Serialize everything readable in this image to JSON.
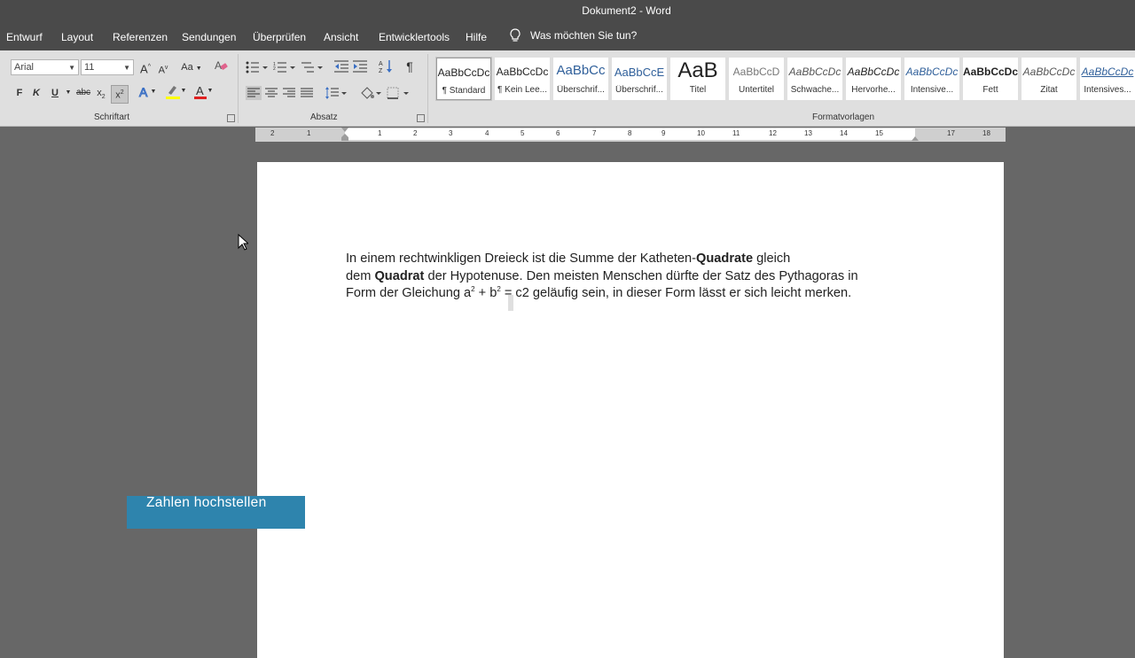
{
  "window": {
    "title_doc": "Dokument2",
    "title_sep": " - ",
    "title_app": "Word"
  },
  "menu": {
    "items": [
      "Entwurf",
      "Layout",
      "Referenzen",
      "Sendungen",
      "Überprüfen",
      "Ansicht",
      "Entwicklertools",
      "Hilfe"
    ],
    "tell_me": "Was möchten Sie tun?"
  },
  "ribbon": {
    "font": {
      "name": "Arial",
      "size": "11",
      "grow_label": "A",
      "shrink_label": "A",
      "case_label": "Aa",
      "bold_label": "F",
      "italic_label": "K",
      "underline_label": "U",
      "strike_label": "abc",
      "sub_label": "x",
      "sup_label": "x",
      "group_label": "Schriftart"
    },
    "paragraph": {
      "group_label": "Absatz"
    },
    "styles": {
      "group_label": "Formatvorlagen",
      "items": [
        {
          "preview": "AaBbCcDc",
          "name": "¶ Standard"
        },
        {
          "preview": "AaBbCcDc",
          "name": "¶ Kein Lee..."
        },
        {
          "preview": "AaBbCc",
          "name": "Überschrif..."
        },
        {
          "preview": "AaBbCcE",
          "name": "Überschrif..."
        },
        {
          "preview": "AaB",
          "name": "Titel"
        },
        {
          "preview": "AaBbCcD",
          "name": "Untertitel"
        },
        {
          "preview": "AaBbCcDc",
          "name": "Schwache..."
        },
        {
          "preview": "AaBbCcDc",
          "name": "Hervorhe..."
        },
        {
          "preview": "AaBbCcDc",
          "name": "Intensive..."
        },
        {
          "preview": "AaBbCcDc",
          "name": "Fett"
        },
        {
          "preview": "AaBbCcDc",
          "name": "Zitat"
        },
        {
          "preview": "AaBbCcDc",
          "name": "Intensives..."
        }
      ]
    },
    "colors": {
      "highlight": "#ffff00",
      "font_color": "#e02020",
      "accent_selected": "#c7c7c7"
    }
  },
  "ruler": {
    "labels": [
      "2",
      "1",
      "1",
      "2",
      "3",
      "4",
      "5",
      "6",
      "7",
      "8",
      "9",
      "10",
      "11",
      "12",
      "13",
      "14",
      "15",
      "17",
      "18"
    ]
  },
  "document": {
    "p1_a": "In einem rechtwinkligen Dreieck ist die Summe der Katheten-",
    "p1_b": "Quadrate",
    "p1_c": " gleich",
    "p2_a": "dem ",
    "p2_b": "Quadrat",
    "p2_c": " der Hypotenuse. Den meisten Menschen dürfte der Satz des Pythagoras in",
    "p3_a": "Form der Gleichung a",
    "p3_sup1": "2",
    "p3_b": " + b",
    "p3_sup2": "2",
    "p3_c": " = c2 geläufig sein, in dieser Form lässt er sich leicht merken."
  },
  "overlay": {
    "caption": "Zahlen hochstellen",
    "caption_color": "#2e84ad"
  }
}
